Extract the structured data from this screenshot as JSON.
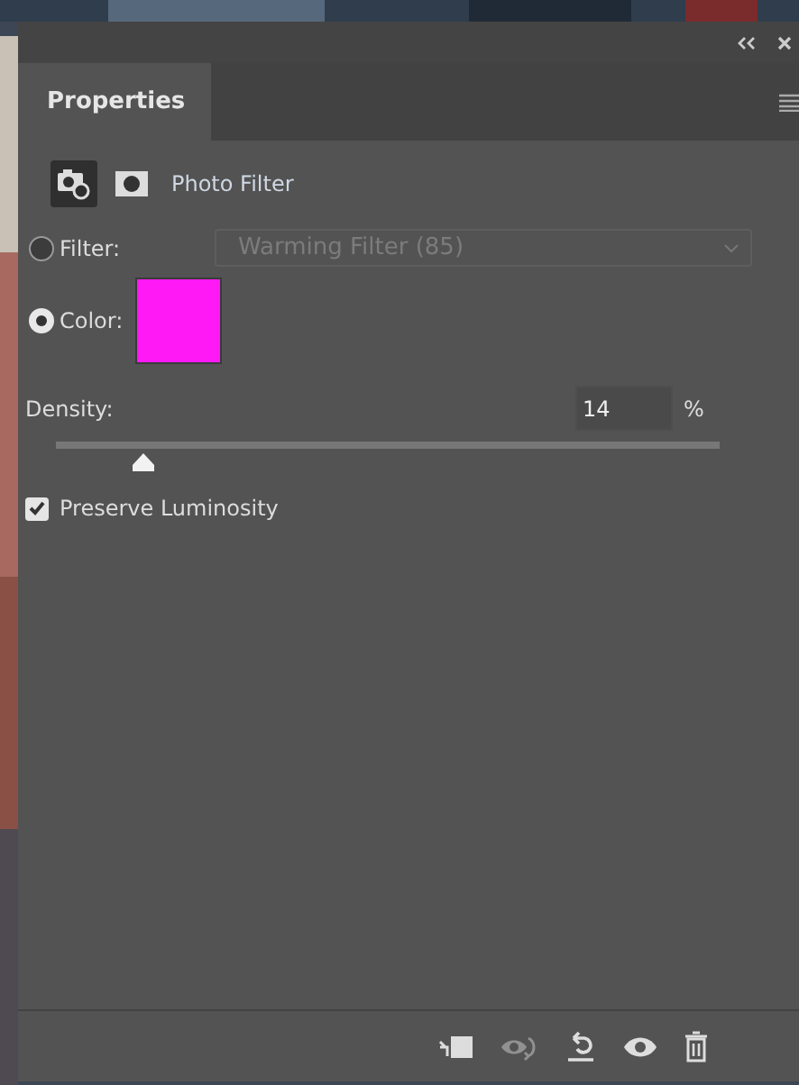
{
  "panel": {
    "tab": {
      "label": "Properties",
      "selected": true
    },
    "modes": [
      {
        "kind": "adjustment",
        "selected": true
      },
      {
        "kind": "mask",
        "selected": false
      }
    ],
    "adjustment": {
      "title": "Photo Filter"
    },
    "filter": {
      "label": "Filter:",
      "selected": false,
      "value": "Warming Filter (85)",
      "disabled": true
    },
    "color": {
      "label": "Color:",
      "selected": true,
      "color": "#ff19f5"
    },
    "density": {
      "label": "Density:",
      "value": "14",
      "unit": "%",
      "level": 0.13
    },
    "preserve_luminosity": {
      "label": "Preserve Luminosity",
      "checked": true
    },
    "toolbar": [
      {
        "kind": "clip",
        "disabled": false
      },
      {
        "kind": "previous",
        "disabled": true
      },
      {
        "kind": "reset",
        "disabled": false
      },
      {
        "kind": "visibility",
        "disabled": false
      },
      {
        "kind": "delete",
        "disabled": false
      }
    ]
  }
}
